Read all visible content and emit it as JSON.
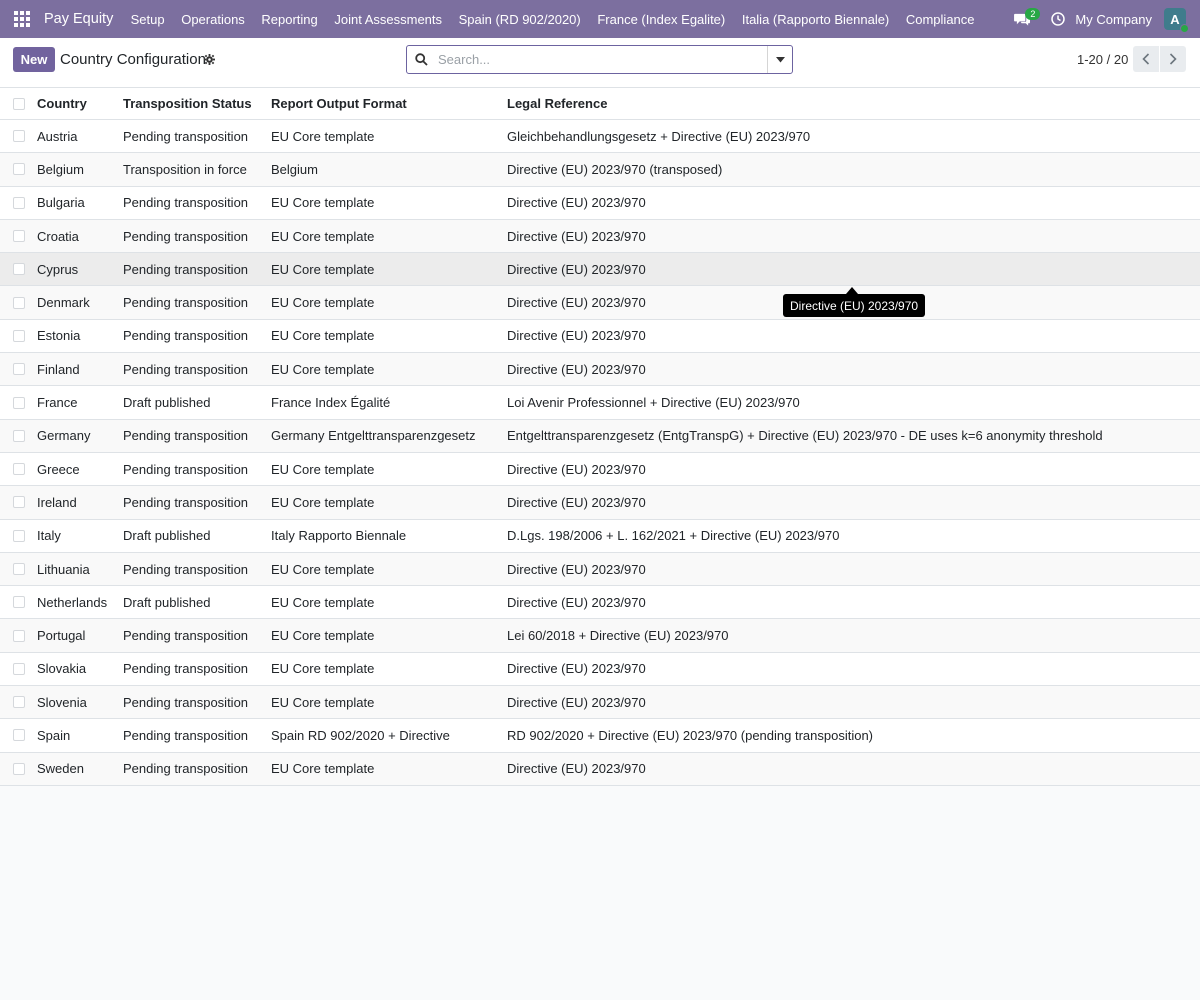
{
  "navbar": {
    "apps_icon": "grid-icon",
    "brand": "Pay Equity",
    "menu": [
      "Setup",
      "Operations",
      "Reporting",
      "Joint Assessments",
      "Spain (RD 902/2020)",
      "France (Index Egalite)",
      "Italia (Rapporto Biennale)",
      "Compliance"
    ],
    "messages_count": "2",
    "company": "My Company",
    "avatar_letter": "A",
    "colors": {
      "bar": "#7c6f9f",
      "badge": "#28a745"
    }
  },
  "control_panel": {
    "new_label": "New",
    "title": "Country Configuration",
    "search_placeholder": "Search...",
    "pager": "1-20 / 20",
    "accent": "#71639e"
  },
  "table": {
    "headers": [
      "Country",
      "Transposition Status",
      "Report Output Format",
      "Legal Reference"
    ],
    "rows": [
      {
        "country": "Austria",
        "status": "Pending transposition",
        "format": "EU Core template",
        "legal": "Gleichbehandlungsgesetz + Directive (EU) 2023/970"
      },
      {
        "country": "Belgium",
        "status": "Transposition in force",
        "format": "Belgium",
        "legal": "Directive (EU) 2023/970 (transposed)"
      },
      {
        "country": "Bulgaria",
        "status": "Pending transposition",
        "format": "EU Core template",
        "legal": "Directive (EU) 2023/970"
      },
      {
        "country": "Croatia",
        "status": "Pending transposition",
        "format": "EU Core template",
        "legal": "Directive (EU) 2023/970"
      },
      {
        "country": "Cyprus",
        "status": "Pending transposition",
        "format": "EU Core template",
        "legal": "Directive (EU) 2023/970"
      },
      {
        "country": "Denmark",
        "status": "Pending transposition",
        "format": "EU Core template",
        "legal": "Directive (EU) 2023/970"
      },
      {
        "country": "Estonia",
        "status": "Pending transposition",
        "format": "EU Core template",
        "legal": "Directive (EU) 2023/970"
      },
      {
        "country": "Finland",
        "status": "Pending transposition",
        "format": "EU Core template",
        "legal": "Directive (EU) 2023/970"
      },
      {
        "country": "France",
        "status": "Draft published",
        "format": "France Index Égalité",
        "legal": "Loi Avenir Professionnel + Directive (EU) 2023/970"
      },
      {
        "country": "Germany",
        "status": "Pending transposition",
        "format": "Germany Entgelttransparenzgesetz",
        "legal": "Entgelttransparenzgesetz (EntgTranspG) + Directive (EU) 2023/970 - DE uses k=6 anonymity threshold"
      },
      {
        "country": "Greece",
        "status": "Pending transposition",
        "format": "EU Core template",
        "legal": "Directive (EU) 2023/970"
      },
      {
        "country": "Ireland",
        "status": "Pending transposition",
        "format": "EU Core template",
        "legal": "Directive (EU) 2023/970"
      },
      {
        "country": "Italy",
        "status": "Draft published",
        "format": "Italy Rapporto Biennale",
        "legal": "D.Lgs. 198/2006 + L. 162/2021 + Directive (EU) 2023/970"
      },
      {
        "country": "Lithuania",
        "status": "Pending transposition",
        "format": "EU Core template",
        "legal": "Directive (EU) 2023/970"
      },
      {
        "country": "Netherlands",
        "status": "Draft published",
        "format": "EU Core template",
        "legal": "Directive (EU) 2023/970"
      },
      {
        "country": "Portugal",
        "status": "Pending transposition",
        "format": "EU Core template",
        "legal": "Lei 60/2018 + Directive (EU) 2023/970"
      },
      {
        "country": "Slovakia",
        "status": "Pending transposition",
        "format": "EU Core template",
        "legal": "Directive (EU) 2023/970"
      },
      {
        "country": "Slovenia",
        "status": "Pending transposition",
        "format": "EU Core template",
        "legal": "Directive (EU) 2023/970"
      },
      {
        "country": "Spain",
        "status": "Pending transposition",
        "format": "Spain RD 902/2020 + Directive",
        "legal": "RD 902/2020 + Directive (EU) 2023/970 (pending transposition)"
      },
      {
        "country": "Sweden",
        "status": "Pending transposition",
        "format": "EU Core template",
        "legal": "Directive (EU) 2023/970"
      }
    ]
  },
  "tooltip": {
    "text": "Directive (EU) 2023/970"
  }
}
